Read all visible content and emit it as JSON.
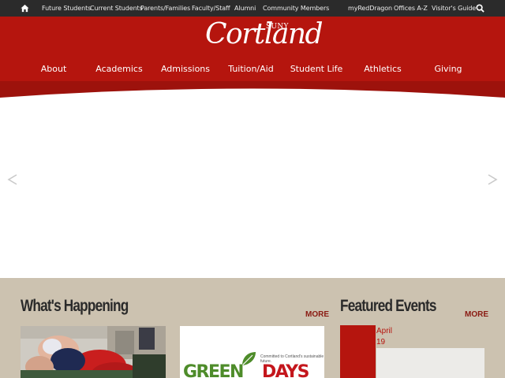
{
  "topbar": {
    "links": [
      "Future Students",
      "Current Students",
      "Parents/Families",
      "Faculty/Staff",
      "Alumni",
      "Community Members"
    ],
    "right_links": [
      "myRedDragon",
      "Offices A-Z",
      "Visitor's Guide"
    ]
  },
  "brand": {
    "suny": "SUNY",
    "name": "Cortland"
  },
  "nav": [
    "About",
    "Academics",
    "Admissions",
    "Tuition/Aid",
    "Student Life",
    "Athletics",
    "Giving"
  ],
  "hero": {
    "prev": "<",
    "next": ">"
  },
  "news": {
    "title": "What's Happening",
    "more": "MORE"
  },
  "card2": {
    "tagline": "Committed to Cortland's sustainable future.",
    "word1": "GREEN",
    "word2": "DAYS"
  },
  "events": {
    "title": "Featured Events",
    "more": "MORE",
    "month": "April",
    "day": "19"
  },
  "colors": {
    "brand_red": "#b5150e",
    "dark_bar": "#2b2b2b",
    "tan": "#ccc2b0",
    "green": "#4e8c2a"
  }
}
